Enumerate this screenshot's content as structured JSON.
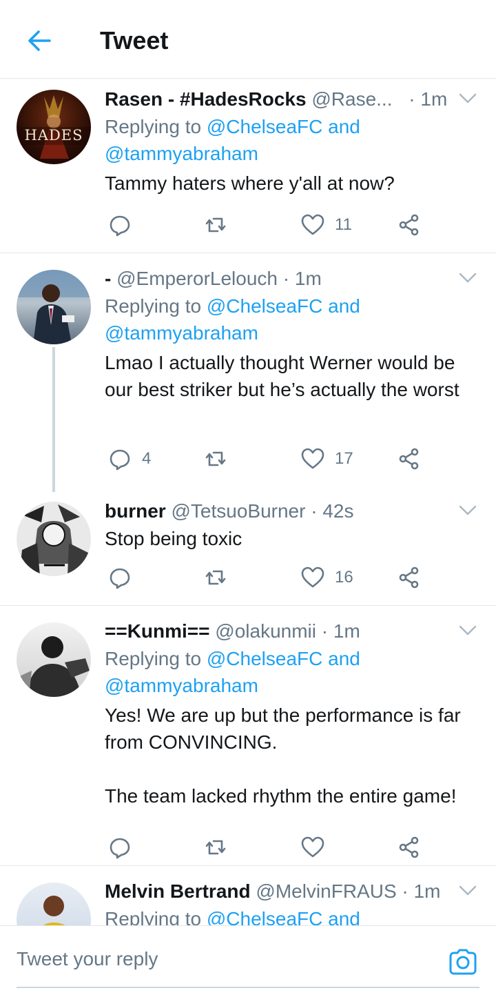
{
  "header": {
    "title": "Tweet",
    "back_icon": "arrow-left-icon"
  },
  "colors": {
    "accent": "#1da1f2",
    "secondary_text": "#657786",
    "divider": "#e1e8ed"
  },
  "tweets": [
    {
      "name": "Rasen - #HadesRocks",
      "handle": "@Rase...",
      "time": "· 1m",
      "reply_prefix": "Replying to ",
      "reply_line1": "@ChelseaFC and",
      "reply_line2": "@tammyabraham",
      "text": "Tammy haters where y'all at now?",
      "replies": "",
      "retweets": "",
      "likes": "11",
      "avatar_text": "HADES"
    },
    {
      "name": "-",
      "handle": "@EmperorLelouch",
      "time": "· 1m",
      "reply_prefix": "Replying to ",
      "reply_line1": "@ChelseaFC and",
      "reply_line2": "@tammyabraham",
      "text": "Lmao I actually thought Werner would be our best striker but he’s actually the worst",
      "replies": "4",
      "retweets": "",
      "likes": "17"
    },
    {
      "name": "burner",
      "handle": "@TetsuoBurner",
      "time": "· 42s",
      "text": "Stop being toxic",
      "replies": "",
      "retweets": "",
      "likes": "16"
    },
    {
      "name": "==Kunmi==",
      "handle": "@olakunmii",
      "time": "· 1m",
      "reply_prefix": "Replying to ",
      "reply_line1": "@ChelseaFC and",
      "reply_line2": "@tammyabraham",
      "text": "Yes! We are up but the performance is far from CONVINCING.\n\nThe team lacked rhythm the entire game!",
      "replies": "",
      "retweets": "",
      "likes": ""
    },
    {
      "name": "Melvin Bertrand",
      "handle": "@MelvinFRAUS",
      "time": "· 1m",
      "reply_prefix": "Replying to ",
      "reply_line1": "@ChelseaFC and"
    }
  ],
  "composer": {
    "placeholder": "Tweet your reply",
    "camera_icon": "camera-icon"
  }
}
